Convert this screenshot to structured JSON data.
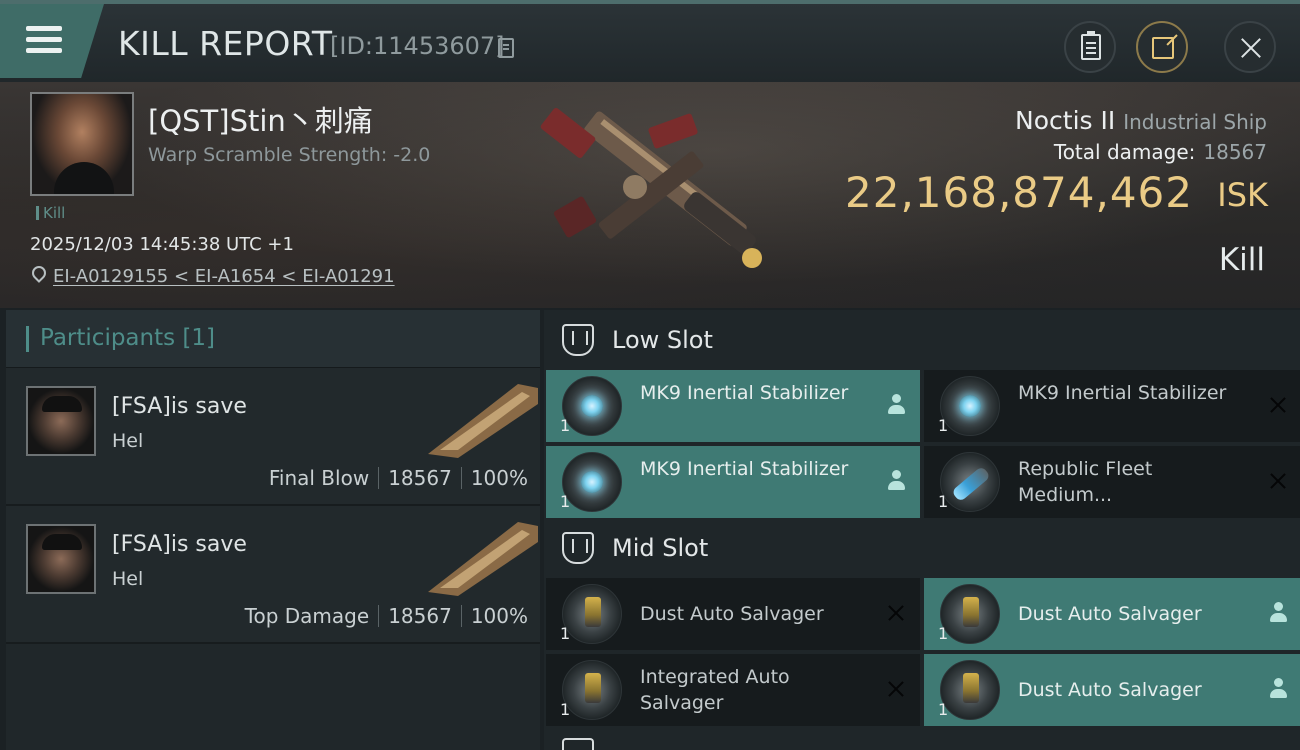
{
  "header": {
    "title": "KILL REPORT",
    "report_id": "[ID:11453607]"
  },
  "victim": {
    "name": "[QST]Stin丶刺痛",
    "warp_scramble": "Warp Scramble Strength: -2.0",
    "tag": "Kill",
    "datetime": "2025/12/03 14:45:38 UTC +1",
    "location": "EI-A0129155 < EI-A1654 < EI-A01291"
  },
  "ship": {
    "name": "Noctis II",
    "class": "Industrial Ship",
    "total_damage_label": "Total damage:",
    "total_damage": "18567",
    "isk_value": "22,168,874,462",
    "isk_unit": "ISK",
    "result": "Kill"
  },
  "participants": {
    "label": "Participants [1]",
    "items": [
      {
        "name": "[FSA]is save",
        "ship": "Hel",
        "role": "Final Blow",
        "damage": "18567",
        "percent": "100%"
      },
      {
        "name": "[FSA]is save",
        "ship": "Hel",
        "role": "Top Damage",
        "damage": "18567",
        "percent": "100%"
      }
    ]
  },
  "low_slot": {
    "label": "Low Slot",
    "modules": [
      {
        "name": "MK9 Inertial Stabilizer",
        "qty": "1",
        "state": "active",
        "icon": "inertial-stabilizer-icon"
      },
      {
        "name": "MK9 Inertial Stabilizer",
        "qty": "1",
        "state": "destroyed",
        "icon": "inertial-stabilizer-icon"
      },
      {
        "name": "MK9 Inertial Stabilizer",
        "qty": "1",
        "state": "active",
        "icon": "inertial-stabilizer-icon"
      },
      {
        "name": "Republic Fleet Medium...",
        "qty": "1",
        "state": "destroyed",
        "icon": "republic-fleet-module-icon"
      }
    ]
  },
  "mid_slot": {
    "label": "Mid Slot",
    "modules": [
      {
        "name": "Dust Auto Salvager",
        "qty": "1",
        "state": "destroyed",
        "icon": "salvager-icon"
      },
      {
        "name": "Dust Auto Salvager",
        "qty": "1",
        "state": "active",
        "icon": "salvager-icon"
      },
      {
        "name": "Integrated Auto Salvager",
        "qty": "1",
        "state": "destroyed",
        "icon": "salvager-icon"
      },
      {
        "name": "Dust Auto Salvager",
        "qty": "1",
        "state": "active",
        "icon": "salvager-icon"
      }
    ]
  },
  "colors": {
    "accent_teal": "#3f7a74",
    "isk_gold": "#eacb86"
  }
}
